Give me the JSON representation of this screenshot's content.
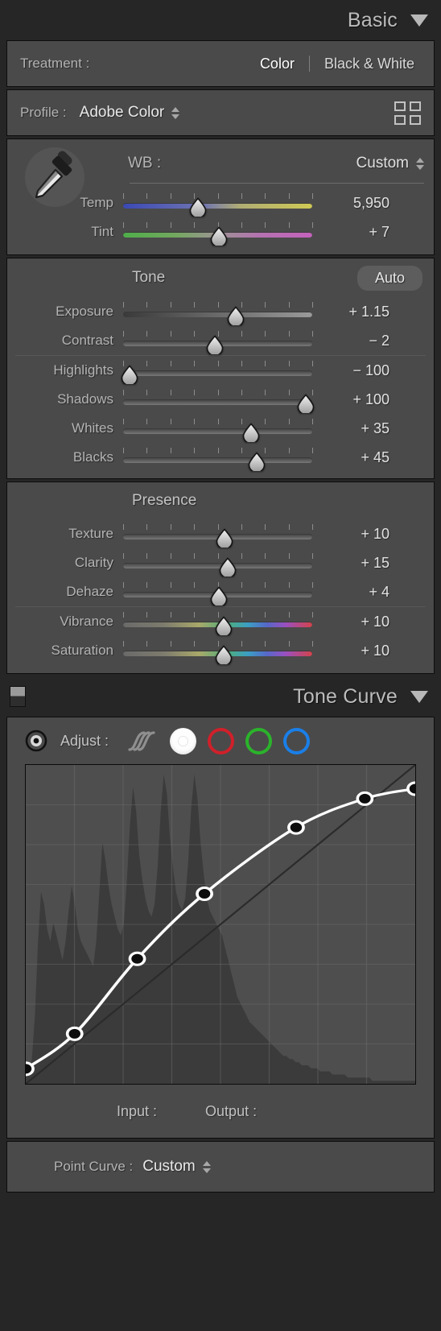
{
  "basic": {
    "title": "Basic",
    "caret": "chevron-down-icon",
    "treatment": {
      "label": "Treatment :",
      "options": [
        {
          "label": "Color",
          "active": true
        },
        {
          "label": "Black & White",
          "active": false
        }
      ]
    },
    "profile": {
      "label": "Profile :",
      "value": "Adobe Color",
      "browse_icon": "profile-grid-icon"
    },
    "wb": {
      "eyedropper_icon": "eyedropper-icon",
      "label": "WB :",
      "value": "Custom",
      "sliders": [
        {
          "name": "Temp",
          "value": "5,950",
          "pos": 0.395,
          "gradient": "temp"
        },
        {
          "name": "Tint",
          "value": "+ 7",
          "pos": 0.505,
          "gradient": "tint"
        }
      ]
    },
    "tone": {
      "title": "Tone",
      "auto_label": "Auto",
      "sliders": [
        {
          "name": "Exposure",
          "value": "+ 1.15",
          "pos": 0.595,
          "gradient": "expo"
        },
        {
          "name": "Contrast",
          "value": "− 2",
          "pos": 0.485,
          "gradient": "plain"
        }
      ],
      "sliders2": [
        {
          "name": "Highlights",
          "value": "− 100",
          "pos": 0.035,
          "gradient": "plain"
        },
        {
          "name": "Shadows",
          "value": "+ 100",
          "pos": 0.965,
          "gradient": "plain"
        },
        {
          "name": "Whites",
          "value": "+ 35",
          "pos": 0.675,
          "gradient": "plain"
        },
        {
          "name": "Blacks",
          "value": "+ 45",
          "pos": 0.705,
          "gradient": "plain"
        }
      ]
    },
    "presence": {
      "title": "Presence",
      "sliders": [
        {
          "name": "Texture",
          "value": "+ 10",
          "pos": 0.535,
          "gradient": "plain"
        },
        {
          "name": "Clarity",
          "value": "+ 15",
          "pos": 0.555,
          "gradient": "plain"
        },
        {
          "name": "Dehaze",
          "value": "+ 4",
          "pos": 0.505,
          "gradient": "plain"
        }
      ],
      "sliders2": [
        {
          "name": "Vibrance",
          "value": "+ 10",
          "pos": 0.53,
          "gradient": "rainbow"
        },
        {
          "name": "Saturation",
          "value": "+ 10",
          "pos": 0.53,
          "gradient": "rainbow"
        }
      ]
    }
  },
  "tone_curve": {
    "title": "Tone Curve",
    "caret": "chevron-down-icon",
    "switch_icon": "panel-switch-icon",
    "adjust": {
      "target_icon": "target-adjustment-icon",
      "label": "Adjust :",
      "channels": [
        {
          "name": "parametric-curve-icon",
          "type": "parametric",
          "active": false
        },
        {
          "name": "master-channel-icon",
          "type": "master",
          "active": true
        },
        {
          "name": "red-channel-icon",
          "type": "red",
          "active": false
        },
        {
          "name": "green-channel-icon",
          "type": "green",
          "active": false
        },
        {
          "name": "blue-channel-icon",
          "type": "blue",
          "active": false
        }
      ]
    },
    "input_label": "Input :",
    "output_label": "Output :",
    "input_value": "",
    "output_value": "",
    "point_curve": {
      "label": "Point Curve :",
      "value": "Custom"
    }
  },
  "chart_data": {
    "type": "line",
    "title": "Tone Curve",
    "xlabel": "Input",
    "ylabel": "Output",
    "xlim": [
      0,
      255
    ],
    "ylim": [
      0,
      255
    ],
    "grid": true,
    "grid_divisions": 8,
    "series": [
      {
        "name": "Point Curve (Custom)",
        "color": "#ffffff",
        "points": [
          {
            "input": 0,
            "output": 12
          },
          {
            "input": 32,
            "output": 40
          },
          {
            "input": 73,
            "output": 100
          },
          {
            "input": 117,
            "output": 152
          },
          {
            "input": 177,
            "output": 205
          },
          {
            "input": 222,
            "output": 228
          },
          {
            "input": 255,
            "output": 236
          }
        ]
      },
      {
        "name": "Linear reference",
        "color": "#2b2b2b",
        "points": [
          {
            "input": 0,
            "output": 0
          },
          {
            "input": 255,
            "output": 255
          }
        ]
      }
    ],
    "histogram": {
      "name": "Luminance histogram",
      "color": "#3a3a3a",
      "bins": [
        2,
        4,
        8,
        22,
        46,
        62,
        58,
        50,
        46,
        52,
        48,
        44,
        40,
        46,
        56,
        64,
        58,
        50,
        46,
        44,
        42,
        40,
        38,
        46,
        62,
        78,
        72,
        64,
        58,
        54,
        50,
        48,
        52,
        66,
        84,
        96,
        88,
        74,
        66,
        60,
        56,
        54,
        58,
        70,
        88,
        100,
        94,
        80,
        70,
        62,
        58,
        56,
        60,
        72,
        90,
        100,
        92,
        78,
        68,
        60,
        56,
        54,
        52,
        50,
        48,
        44,
        40,
        36,
        32,
        28,
        26,
        24,
        22,
        20,
        19,
        18,
        17,
        16,
        15,
        14,
        13,
        12,
        11,
        10,
        9,
        9,
        8,
        8,
        7,
        7,
        6,
        6,
        6,
        5,
        5,
        5,
        4,
        4,
        4,
        4,
        3,
        3,
        3,
        3,
        3,
        2,
        2,
        2,
        2,
        2,
        2,
        2,
        2,
        1,
        1,
        1,
        1,
        1,
        1,
        1,
        1,
        1,
        1,
        1,
        1,
        1,
        1,
        1
      ]
    }
  }
}
